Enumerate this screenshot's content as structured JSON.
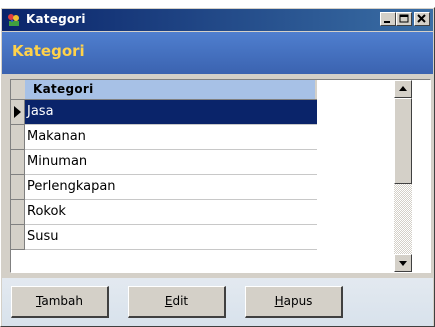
{
  "window": {
    "title": "Kategori",
    "icon": "app-cart-icon",
    "controls": [
      "minimize-icon",
      "maximize-icon",
      "close-icon"
    ]
  },
  "banner": {
    "title": "Kategori",
    "text_color": "#ffd24a",
    "bg_color": "#3b63b0"
  },
  "grid": {
    "column_header": "Kategori",
    "selected_index": 0,
    "rows": [
      "Jasa",
      "Makanan",
      "Minuman",
      "Perlengkapan",
      "Rokok",
      "Susu"
    ],
    "selection_color": "#0a246a"
  },
  "buttons": {
    "tambah": {
      "hotkey": "T",
      "rest": "ambah"
    },
    "edit": {
      "hotkey": "E",
      "rest": "dit"
    },
    "hapus": {
      "hotkey": "H",
      "rest": "apus"
    }
  }
}
